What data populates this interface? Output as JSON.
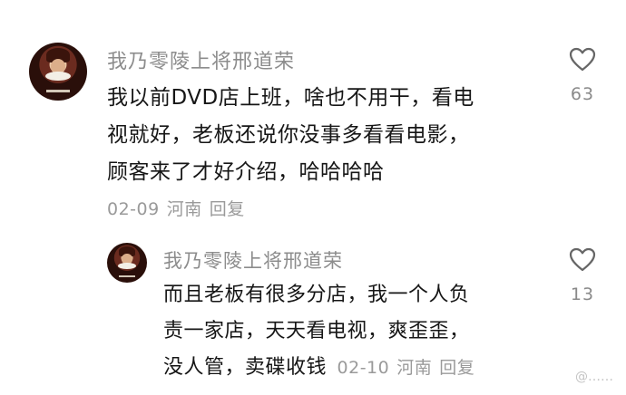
{
  "comments": [
    {
      "username": "我乃零陵上将邢道荣",
      "lines": [
        "我以前DVD店上班，啥也不用干，看电",
        "视就好，老板还说你没事多看看电影，",
        "顾客来了才好介绍，哈哈哈哈"
      ],
      "date": "02-09",
      "location": "河南",
      "reply_label": "回复",
      "like_count": "63",
      "like_icon": "heart-outline-icon"
    }
  ],
  "replies": [
    {
      "username": "我乃零陵上将邢道荣",
      "lines": [
        "而且老板有很多分店，我一个人负",
        "责一家店，天天看电视，爽歪歪，",
        "没人管，卖碟收钱"
      ],
      "date": "02-10",
      "location": "河南",
      "reply_label": "回复",
      "like_count": "13",
      "like_icon": "heart-outline-icon"
    }
  ],
  "watermark": "@……"
}
